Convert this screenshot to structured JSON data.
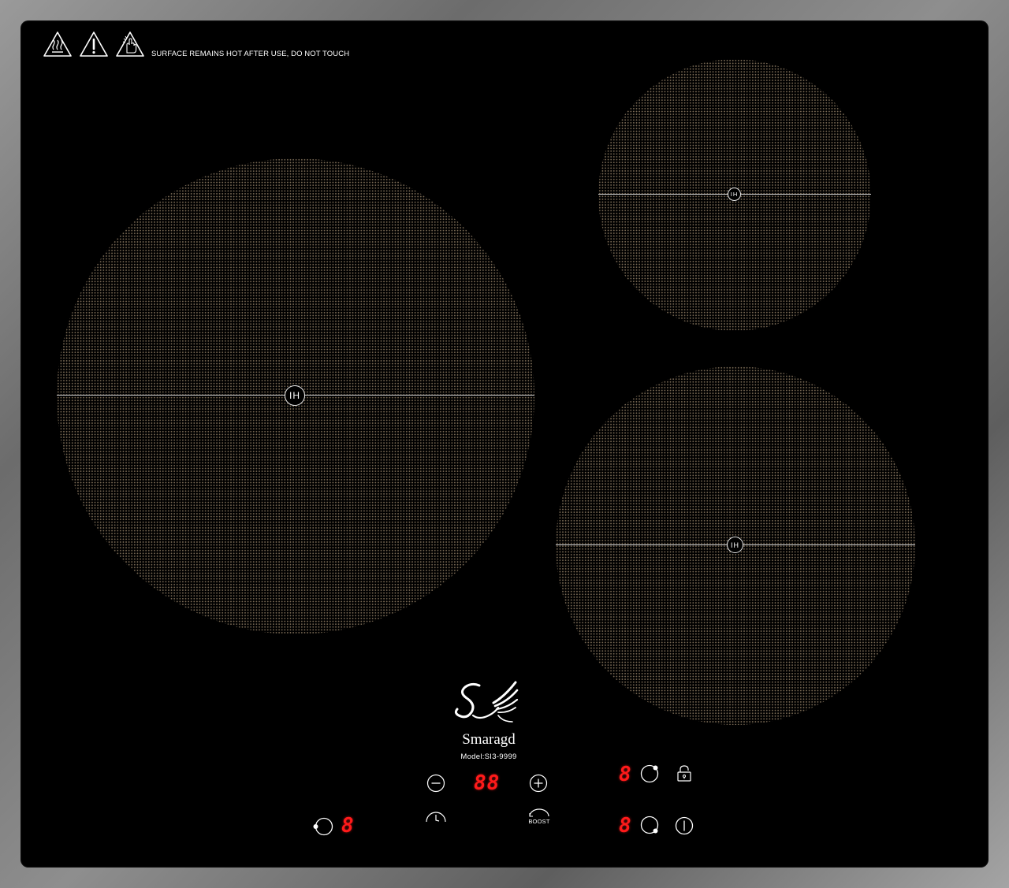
{
  "warning": {
    "text": "SURFACE REMAINS HOT AFTER USE, DO NOT TOUCH",
    "icons": [
      "hot-surface-warning-icon",
      "exclamation-warning-icon",
      "do-not-touch-warning-icon"
    ]
  },
  "zones": [
    {
      "id": "large-left",
      "label": "IH"
    },
    {
      "id": "small-top-right",
      "label": "IH"
    },
    {
      "id": "medium-bottom-right",
      "label": "IH"
    }
  ],
  "brand": {
    "name": "Smaragd",
    "model": "Model:SI3-9999"
  },
  "controls": {
    "timer_display": "88",
    "zone_left_display": "8",
    "zone_top_right_display": "8",
    "zone_bottom_right_display": "8",
    "boost_label": "BOOST"
  },
  "colors": {
    "glass": "#000000",
    "frame": "#7a7a7a",
    "display_red": "#ff1a1a",
    "zone_dots": "#7a6a55",
    "print_white": "#ffffff"
  }
}
